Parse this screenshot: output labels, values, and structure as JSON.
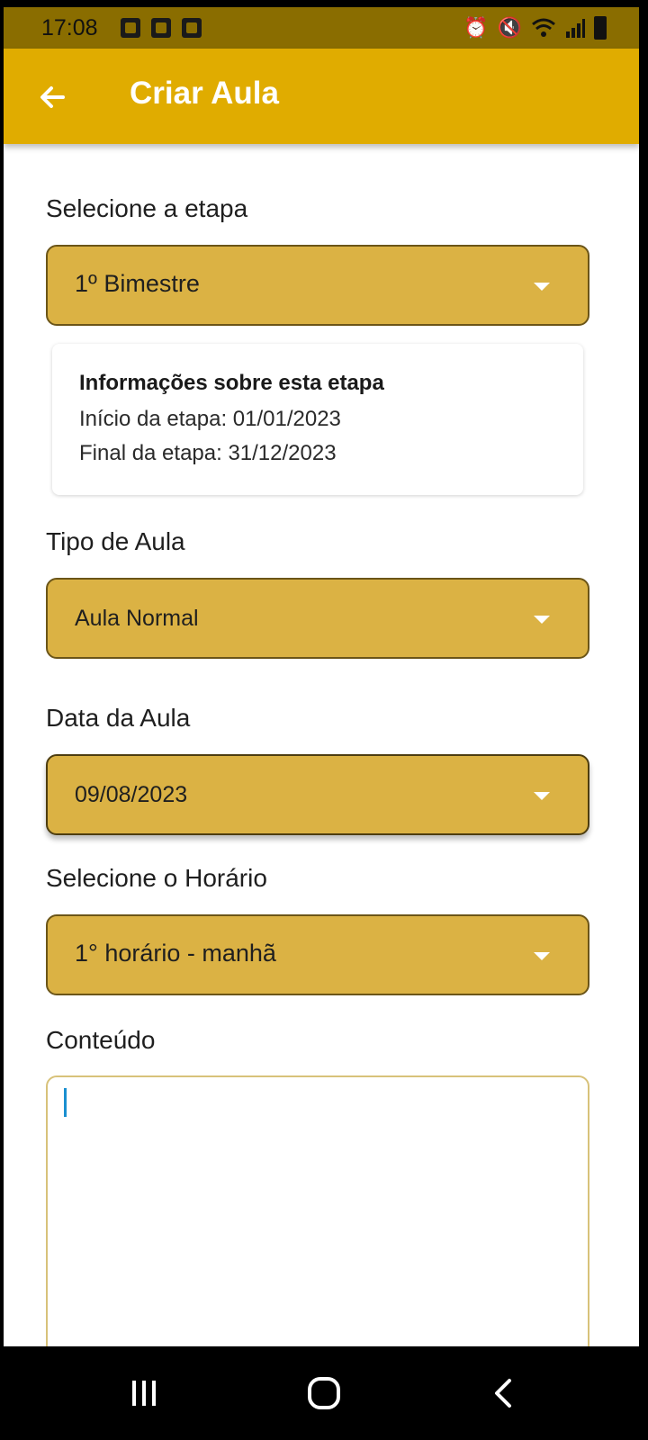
{
  "status_bar": {
    "time": "17:08",
    "left_icons": [
      "voicemail-icon",
      "media-icon",
      "storage-icon"
    ],
    "right_icons": [
      "alarm-icon",
      "mute-icon",
      "wifi-icon",
      "signal-icon",
      "battery-icon"
    ]
  },
  "app_bar": {
    "title": "Criar Aula",
    "back_icon": "arrow-left-icon",
    "background": "#e0ac00"
  },
  "form": {
    "etapa": {
      "label": "Selecione a etapa",
      "value": "1º Bimestre"
    },
    "info_card": {
      "title": "Informações sobre esta etapa",
      "start": "Início da etapa: 01/01/2023",
      "end": "Final da etapa: 31/12/2023"
    },
    "tipo": {
      "label": "Tipo de Aula",
      "value": "Aula Normal"
    },
    "data": {
      "label": "Data da Aula",
      "value": "09/08/2023"
    },
    "horario": {
      "label": "Selecione o Horário",
      "value": "1° horário - manhã"
    },
    "conteudo": {
      "label": "Conteúdo",
      "value": ""
    }
  },
  "colors": {
    "dropdown_fill": "#dbb244",
    "accent": "#e0ac00",
    "caret": "#1a8fd0"
  },
  "nav_bar": {
    "buttons": [
      "recent-apps-icon",
      "home-icon",
      "back-icon"
    ]
  }
}
